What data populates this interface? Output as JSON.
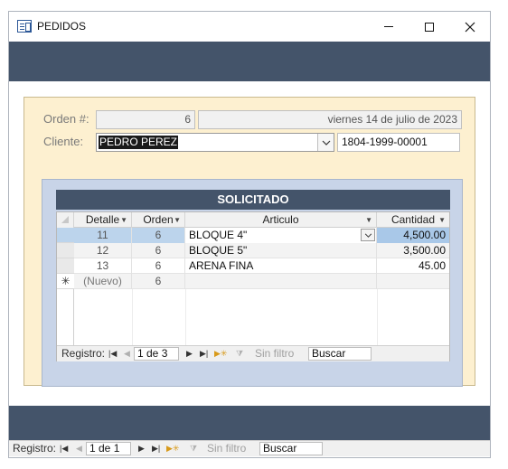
{
  "window": {
    "title": "PEDIDOS",
    "controls": {
      "minimize": "minimize-icon",
      "maximize": "maximize-icon",
      "close": "close-icon"
    }
  },
  "form": {
    "orden_label": "Orden #:",
    "orden_value": "6",
    "fecha_value": "viernes 14 de julio de 2023",
    "cliente_label": "Cliente:",
    "cliente_value": "PEDRO PEREZ",
    "cliente_id": "1804-1999-00001"
  },
  "subform": {
    "title": "SOLICITADO",
    "columns": [
      "Detalle",
      "Orden",
      "Articulo",
      "Cantidad"
    ],
    "rows": [
      {
        "detalle": "11",
        "orden": "6",
        "articulo": "BLOQUE 4\"",
        "cantidad": "4,500.00"
      },
      {
        "detalle": "12",
        "orden": "6",
        "articulo": "BLOQUE 5\"",
        "cantidad": "3,500.00"
      },
      {
        "detalle": "13",
        "orden": "6",
        "articulo": "ARENA FINA",
        "cantidad": "45.00"
      }
    ],
    "new_row": {
      "detalle": "(Nuevo)",
      "orden": "6",
      "marker": "✳"
    },
    "nav": {
      "label": "Registro:",
      "position": "1 de 3",
      "filter": "Sin filtro",
      "search": "Buscar"
    }
  },
  "main_nav": {
    "label": "Registro:",
    "position": "1 de 1",
    "filter": "Sin filtro",
    "search": "Buscar"
  },
  "colors": {
    "band": "#44546a",
    "form_bg": "#fdf0d0",
    "subform_bg": "#c8d4e8",
    "selection": "#bcd4ec"
  }
}
